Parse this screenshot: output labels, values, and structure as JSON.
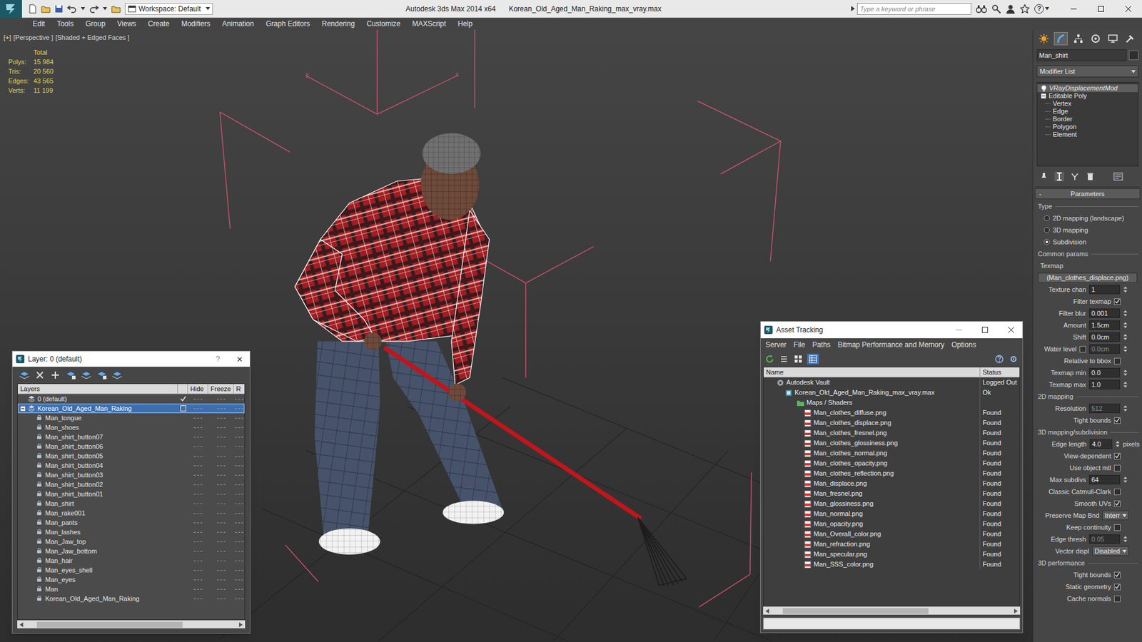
{
  "window": {
    "app_title": "Autodesk 3ds Max 2014 x64",
    "file_title": "Korean_Old_Aged_Man_Raking_max_vray.max",
    "workspace": "Workspace: Default",
    "search_placeholder": "Type a keyword or phrase",
    "help": "?"
  },
  "menu": [
    "Edit",
    "Tools",
    "Group",
    "Views",
    "Create",
    "Modifiers",
    "Animation",
    "Graph Editors",
    "Rendering",
    "Customize",
    "MAXScript",
    "Help"
  ],
  "viewport": {
    "labels": [
      "[+]",
      "[Perspective ]",
      "[Shaded + Edged Faces ]"
    ],
    "axis_labels": [
      "y",
      "x"
    ],
    "stats_title": "Total",
    "stats": [
      {
        "label": "Polys:",
        "value": "15 984"
      },
      {
        "label": "Tris:",
        "value": "20 560"
      },
      {
        "label": "Edges:",
        "value": "43 565"
      },
      {
        "label": "Verts:",
        "value": "11 199"
      }
    ]
  },
  "layer_dialog": {
    "title": "Layer: 0 (default)",
    "help": "?",
    "close": "×",
    "columns": [
      "Layers",
      "Hide",
      "Freeze",
      "R"
    ],
    "rows": [
      {
        "name": "0 (default)",
        "kind": "layer",
        "current": true,
        "selected": false
      },
      {
        "name": "Korean_Old_Aged_Man_Raking",
        "kind": "layer",
        "current": false,
        "selected": true,
        "expanded": true
      },
      {
        "name": "Man_tongue",
        "kind": "object",
        "current": false,
        "selected": false
      },
      {
        "name": "Man_shoes",
        "kind": "object",
        "current": false,
        "selected": false
      },
      {
        "name": "Man_shirt_button07",
        "kind": "object",
        "current": false,
        "selected": false
      },
      {
        "name": "Man_shirt_button06",
        "kind": "object",
        "current": false,
        "selected": false
      },
      {
        "name": "Man_shirt_button05",
        "kind": "object",
        "current": false,
        "selected": false
      },
      {
        "name": "Man_shirt_button04",
        "kind": "object",
        "current": false,
        "selected": false
      },
      {
        "name": "Man_shirt_button03",
        "kind": "object",
        "current": false,
        "selected": false
      },
      {
        "name": "Man_shirt_button02",
        "kind": "object",
        "current": false,
        "selected": false
      },
      {
        "name": "Man_shirt_button01",
        "kind": "object",
        "current": false,
        "selected": false
      },
      {
        "name": "Man_shirt",
        "kind": "object",
        "current": false,
        "selected": false
      },
      {
        "name": "Man_rake001",
        "kind": "object",
        "current": false,
        "selected": false
      },
      {
        "name": "Man_pants",
        "kind": "object",
        "current": false,
        "selected": false
      },
      {
        "name": "Man_lashes",
        "kind": "object",
        "current": false,
        "selected": false
      },
      {
        "name": "Man_Jaw_top",
        "kind": "object",
        "current": false,
        "selected": false
      },
      {
        "name": "Man_Jaw_bottom",
        "kind": "object",
        "current": false,
        "selected": false
      },
      {
        "name": "Man_hair",
        "kind": "object",
        "current": false,
        "selected": false
      },
      {
        "name": "Man_eyes_shell",
        "kind": "object",
        "current": false,
        "selected": false
      },
      {
        "name": "Man_eyes",
        "kind": "object",
        "current": false,
        "selected": false
      },
      {
        "name": "Man",
        "kind": "object",
        "current": false,
        "selected": false
      },
      {
        "name": "Korean_Old_Aged_Man_Raking",
        "kind": "object",
        "current": false,
        "selected": false
      }
    ]
  },
  "asset_tracking": {
    "title": "Asset Tracking",
    "menu": [
      "Server",
      "File",
      "Paths",
      "Bitmap Performance and Memory",
      "Options"
    ],
    "columns": [
      "Name",
      "Status"
    ],
    "rows": [
      {
        "name": "Autodesk Vault",
        "kind": "vault",
        "status": "Logged Out"
      },
      {
        "name": "Korean_Old_Aged_Man_Raking_max_vray.max",
        "kind": "file",
        "status": "Ok"
      },
      {
        "name": "Maps / Shaders",
        "kind": "folder"
      },
      {
        "name": "Man_clothes_diffuse.png",
        "kind": "map",
        "status": "Found"
      },
      {
        "name": "Man_clothes_displace.png",
        "kind": "map",
        "status": "Found"
      },
      {
        "name": "Man_clothes_fresnel.png",
        "kind": "map",
        "status": "Found"
      },
      {
        "name": "Man_clothes_glossiness.png",
        "kind": "map",
        "status": "Found"
      },
      {
        "name": "Man_clothes_normal.png",
        "kind": "map",
        "status": "Found"
      },
      {
        "name": "Man_clothes_opacity.png",
        "kind": "map",
        "status": "Found"
      },
      {
        "name": "Man_clothes_reflection.png",
        "kind": "map",
        "status": "Found"
      },
      {
        "name": "Man_displace.png",
        "kind": "map",
        "status": "Found"
      },
      {
        "name": "Man_fresnel.png",
        "kind": "map",
        "status": "Found"
      },
      {
        "name": "Man_glossiness.png",
        "kind": "map",
        "status": "Found"
      },
      {
        "name": "Man_normal.png",
        "kind": "map",
        "status": "Found"
      },
      {
        "name": "Man_opacity.png",
        "kind": "map",
        "status": "Found"
      },
      {
        "name": "Man_Overall_color.png",
        "kind": "map",
        "status": "Found"
      },
      {
        "name": "Man_refraction.png",
        "kind": "map",
        "status": "Found"
      },
      {
        "name": "Man_specular.png",
        "kind": "map",
        "status": "Found"
      },
      {
        "name": "Man_SSS_color.png",
        "kind": "map",
        "status": "Found"
      }
    ]
  },
  "command_panel": {
    "tabs": [
      {
        "selected": false
      },
      {
        "selected": true
      },
      {
        "selected": false
      },
      {
        "selected": false
      },
      {
        "selected": false
      },
      {
        "selected": false
      }
    ],
    "object_name": "Man_shirt",
    "modifier_list": "Modifier List",
    "stack": [
      {
        "label": "VRayDisplacementMod",
        "kind": "modifier",
        "on": true,
        "selected": true
      },
      {
        "label": "Editable Poly",
        "kind": "base",
        "expanded": true,
        "selected": false
      },
      {
        "label": "Vertex",
        "kind": "sub",
        "selected": false
      },
      {
        "label": "Edge",
        "kind": "sub",
        "selected": false
      },
      {
        "label": "Border",
        "kind": "sub",
        "selected": false
      },
      {
        "label": "Polygon",
        "kind": "sub",
        "selected": false
      },
      {
        "label": "Element",
        "kind": "sub",
        "selected": false
      }
    ],
    "parameters": [
      {
        "kind": "rollout",
        "toggle": "-",
        "label": "Parameters"
      },
      {
        "kind": "group",
        "label": "Type"
      },
      {
        "kind": "radio",
        "label": "2D mapping (landscape)",
        "selected": false
      },
      {
        "kind": "radio",
        "label": "3D mapping",
        "selected": false
      },
      {
        "kind": "radio",
        "label": "Subdivision",
        "selected": true
      },
      {
        "kind": "group",
        "label": "Common params"
      },
      {
        "kind": "label",
        "label": "Texmap"
      },
      {
        "kind": "button",
        "label": "(Man_clothes_displace.png)"
      },
      {
        "kind": "spinner",
        "label": "Texture chan",
        "value": "1",
        "disabled": false
      },
      {
        "kind": "check",
        "label": "Filter texmap",
        "checked": true
      },
      {
        "kind": "spinner",
        "label": "Filter blur",
        "value": "0.001",
        "disabled": false
      },
      {
        "kind": "spinner",
        "label": "Amount",
        "value": "1.5cm",
        "disabled": false
      },
      {
        "kind": "spinner",
        "label": "Shift",
        "value": "0.0cm",
        "disabled": false
      },
      {
        "kind": "check_spinner",
        "label": "Water level",
        "checked": false,
        "value": "0.0cm",
        "disabled": true
      },
      {
        "kind": "check",
        "label": "Relative to bbox",
        "checked": false
      },
      {
        "kind": "spinner",
        "label": "Texmap min",
        "value": "0.0",
        "disabled": false
      },
      {
        "kind": "spinner",
        "label": "Texmap max",
        "value": "1.0",
        "disabled": false
      },
      {
        "kind": "group",
        "label": "2D mapping"
      },
      {
        "kind": "spinner",
        "label": "Resolution",
        "value": "512",
        "disabled": true
      },
      {
        "kind": "check",
        "label": "Tight bounds",
        "checked": true
      },
      {
        "kind": "group",
        "label": "3D mapping/subdivision"
      },
      {
        "kind": "spinner",
        "label": "Edge length",
        "value": "4.0",
        "unit": "pixels",
        "disabled": false
      },
      {
        "kind": "check",
        "label": "View-dependent",
        "checked": true
      },
      {
        "kind": "check",
        "label": "Use object mtl",
        "checked": false
      },
      {
        "kind": "spinner",
        "label": "Max subdivs",
        "value": "64",
        "disabled": false
      },
      {
        "kind": "check",
        "label": "Classic Catmull-Clark",
        "checked": false
      },
      {
        "kind": "check",
        "label": "Smooth UVs",
        "checked": true
      },
      {
        "kind": "dropdown",
        "label": "Preserve Map Bnd",
        "value": "Interr"
      },
      {
        "kind": "check",
        "label": "Keep continuity",
        "checked": false
      },
      {
        "kind": "spinner",
        "label": "Edge thresh",
        "value": "0.05",
        "disabled": true
      },
      {
        "kind": "dropdown",
        "label": "Vector displ",
        "value": "Disabled"
      },
      {
        "kind": "group",
        "label": "3D performance"
      },
      {
        "kind": "check",
        "label": "Tight bounds",
        "checked": true
      },
      {
        "kind": "check",
        "label": "Static geometry",
        "checked": true
      },
      {
        "kind": "check",
        "label": "Cache normals",
        "checked": false
      }
    ]
  }
}
